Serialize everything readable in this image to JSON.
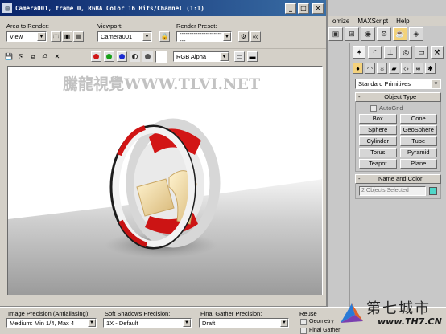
{
  "max_app": {
    "menu": [
      "omize",
      "MAXScript",
      "Help"
    ],
    "toolbar_icons": [
      "render-frame-icon",
      "graph-icon",
      "material-editor-icon",
      "render-setup-icon",
      "teapot-render-icon"
    ],
    "command_panel": {
      "tabs": [
        "create-tab-icon",
        "modify-tab-icon",
        "hierarchy-tab-icon",
        "motion-tab-icon",
        "display-tab-icon",
        "utilities-tab-icon"
      ],
      "subtabs": [
        "geometry-icon",
        "shapes-icon",
        "lights-icon",
        "cameras-icon",
        "helpers-icon",
        "spacewarps-icon",
        "systems-icon"
      ],
      "category": "Standard Primitives",
      "object_type_title": "Object Type",
      "autogrid": "AutoGrid",
      "objects": [
        "Box",
        "Cone",
        "Sphere",
        "GeoSphere",
        "Cylinder",
        "Tube",
        "Torus",
        "Pyramid",
        "Teapot",
        "Plane"
      ],
      "name_color_title": "Name and Color",
      "name_value": "2 Objects Selected",
      "swatch_color": "#4fd6c8"
    }
  },
  "render_window": {
    "title": "Camera001, frame 0, RGBA Color 16 Bits/Channel (1:1)",
    "area_label": "Area to Render:",
    "area_value": "View",
    "viewport_label": "Viewport:",
    "viewport_value": "Camera001",
    "preset_label": "Render Preset:",
    "preset_value": "------------------------",
    "channel_value": "RGB Alpha",
    "channel_colors": [
      "#d01818",
      "#18a018",
      "#1a2ad0"
    ],
    "watermark": "騰龍視覺WWW.TLVI.NET"
  },
  "status_bar": {
    "image_precision_label": "Image Precision (Antialiasing):",
    "image_precision_value": "Medium: Min 1/4, Max 4",
    "shadows_label": "Soft Shadows Precision:",
    "shadows_value": "1X - Default",
    "gather_label": "Final Gather Precision:",
    "gather_value": "Draft",
    "reuse_label": "Reuse",
    "geometry_label": "Geometry",
    "final_gather_label": "Final Gather"
  },
  "logo": {
    "chinese": "第七城市",
    "url": "www.TH7.CN"
  }
}
